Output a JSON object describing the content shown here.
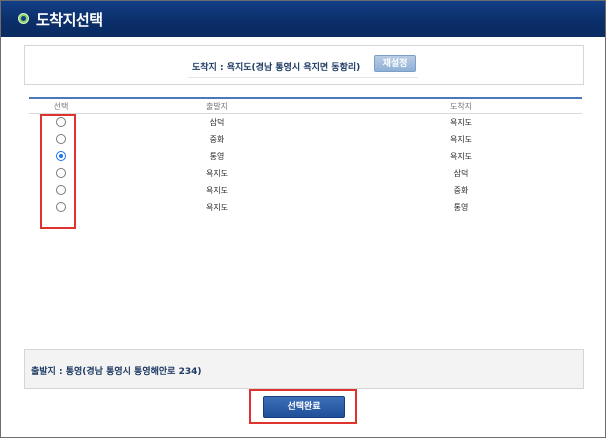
{
  "window": {
    "title": "도착지선택"
  },
  "destination": {
    "label": "도착지 : 욕지도(경남 통영시 욕지면 동항리)",
    "reset_label": "재설정"
  },
  "table": {
    "headers": {
      "select": "선택",
      "origin": "출발지",
      "destination": "도착지"
    },
    "rows": [
      {
        "origin": "삼덕",
        "destination": "욕지도",
        "selected": false
      },
      {
        "origin": "중화",
        "destination": "욕지도",
        "selected": false
      },
      {
        "origin": "통영",
        "destination": "욕지도",
        "selected": true
      },
      {
        "origin": "욕지도",
        "destination": "삼덕",
        "selected": false
      },
      {
        "origin": "욕지도",
        "destination": "중화",
        "selected": false
      },
      {
        "origin": "욕지도",
        "destination": "통영",
        "selected": false
      }
    ]
  },
  "origin_info": {
    "label": "출발지 : 통영(경남 통영시 통영해안로 234)"
  },
  "actions": {
    "complete_label": "선택완료"
  },
  "colors": {
    "title_bar": "#0b2f6a",
    "accent": "#4a79b8",
    "highlight": "#e0332f"
  }
}
